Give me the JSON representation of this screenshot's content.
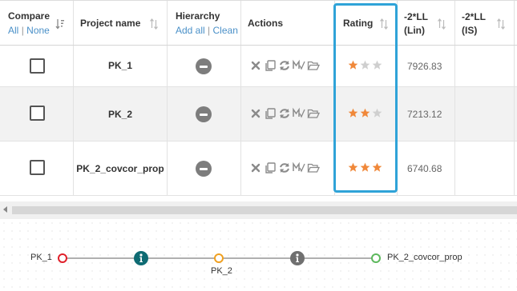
{
  "header": {
    "compare": {
      "title": "Compare",
      "all": "All",
      "sep": "|",
      "none": "None"
    },
    "project_name": "Project name",
    "hierarchy": {
      "title": "Hierarchy",
      "add_all": "Add all",
      "sep": "|",
      "clean": "Clean"
    },
    "actions": "Actions",
    "rating": "Rating",
    "lin": {
      "line1": "-2*LL",
      "line2": "(Lin)"
    },
    "is": {
      "line1": "-2*LL",
      "line2": "(IS)"
    }
  },
  "rows": [
    {
      "project": "PK_1",
      "rating": 1,
      "lin": "7926.83",
      "is": ""
    },
    {
      "project": "PK_2",
      "rating": 2,
      "lin": "7213.12",
      "is": ""
    },
    {
      "project": "PK_2_covcor_prop",
      "rating": 3,
      "lin": "6740.68",
      "is": ""
    }
  ],
  "action_icons": [
    "close-icon",
    "copy-icon",
    "refresh-icon",
    "model-edit-icon",
    "folder-open-icon"
  ],
  "rating_max": 3,
  "colors": {
    "star_on": "#f0883a",
    "star_off": "#cfcfcf",
    "highlight": "#2fa3d8",
    "link": "#4a90c8"
  },
  "timeline": {
    "start_label": "PK_1",
    "middle_label": "PK_2",
    "end_label": "PK_2_covcor_prop",
    "nodes": [
      {
        "kind": "ring",
        "color": "#e0202a"
      },
      {
        "kind": "info",
        "color": "#0f6b73"
      },
      {
        "kind": "ring",
        "color": "#f0a020"
      },
      {
        "kind": "info",
        "color": "#707070"
      },
      {
        "kind": "ring",
        "color": "#5cb85c"
      }
    ]
  }
}
